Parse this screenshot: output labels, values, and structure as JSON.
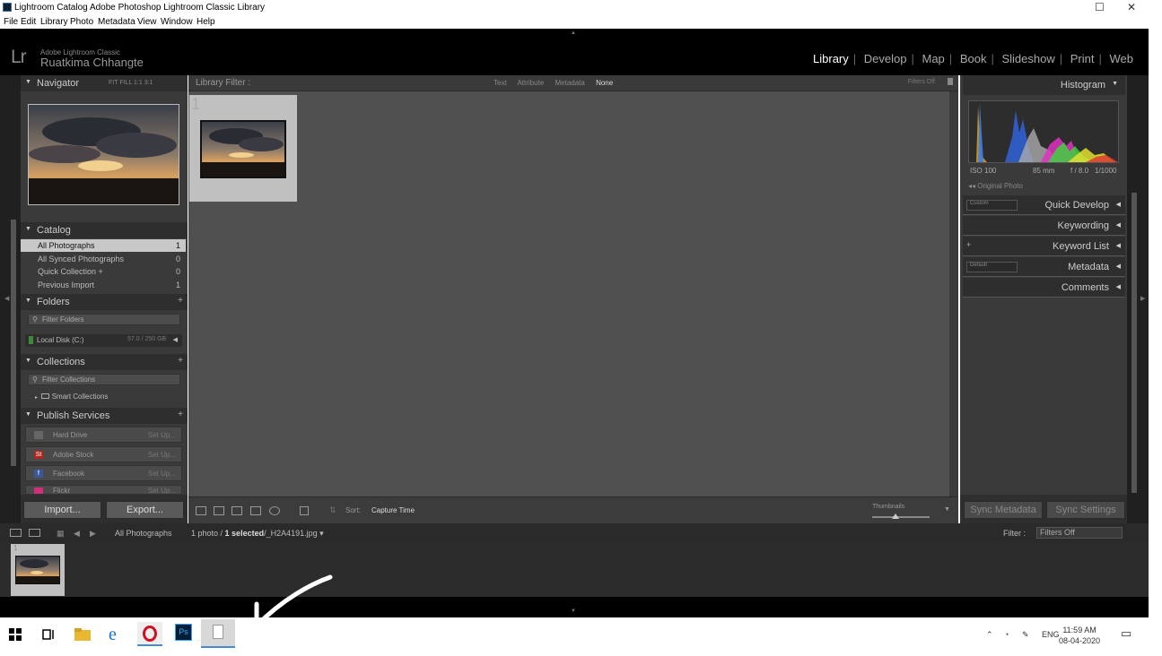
{
  "window": {
    "title": "Lightroom Catalog  Adobe Photoshop Lightroom Classic  Library",
    "menu": [
      "File",
      "Edit",
      "Library",
      "Photo",
      "Metadata",
      "View",
      "Window",
      "Help"
    ]
  },
  "identity": {
    "logo": "Lr",
    "app_name": "Adobe Lightroom Classic",
    "user": "Ruatkima Chhangte"
  },
  "modules": [
    {
      "label": "Library",
      "active": true
    },
    {
      "label": "Develop",
      "active": false
    },
    {
      "label": "Map",
      "active": false
    },
    {
      "label": "Book",
      "active": false
    },
    {
      "label": "Slideshow",
      "active": false
    },
    {
      "label": "Print",
      "active": false
    },
    {
      "label": "Web",
      "active": false
    }
  ],
  "left_panel": {
    "navigator": {
      "title": "Navigator",
      "zoom_options": [
        "FIT",
        "FILL",
        "1:1",
        "3:1"
      ]
    },
    "catalog": {
      "title": "Catalog",
      "items": [
        {
          "name": "All Photographs",
          "count": "1"
        },
        {
          "name": "All Synced Photographs",
          "count": "0"
        },
        {
          "name": "Quick Collection +",
          "count": "0"
        },
        {
          "name": "Previous Import",
          "count": "1"
        }
      ]
    },
    "folders": {
      "title": "Folders",
      "filter": "Filter Folders",
      "disk": "Local Disk (C:)",
      "disk_size": "57.0 / 250 GB"
    },
    "collections": {
      "title": "Collections",
      "filter": "Filter Collections",
      "smart": "Smart Collections"
    },
    "publish": {
      "title": "Publish Services",
      "items": [
        {
          "name": "Hard Drive",
          "action": "Set Up...",
          "icon": "hard-drive-icon",
          "color": "#666666"
        },
        {
          "name": "Adobe Stock",
          "action": "Set Up...",
          "icon": "adobe-stock-icon",
          "color": "#b3261e",
          "glyph": "St"
        },
        {
          "name": "Facebook",
          "action": "Set Up...",
          "icon": "facebook-icon",
          "color": "#3b5998",
          "glyph": "f"
        },
        {
          "name": "Flickr",
          "action": "Set Up...",
          "icon": "flickr-icon",
          "color": "#d0307a",
          "glyph": ""
        }
      ]
    },
    "import_label": "Import...",
    "export_label": "Export..."
  },
  "filter_bar": {
    "label": "Library Filter :",
    "options": [
      {
        "label": "Text",
        "on": false
      },
      {
        "label": "Attribute",
        "on": false
      },
      {
        "label": "Metadata",
        "on": false
      },
      {
        "label": "None",
        "on": true
      }
    ],
    "filters_off": "Filters Off"
  },
  "grid": {
    "cell_number": "1"
  },
  "toolbar": {
    "sort_label": "Sort:",
    "sort_value": "Capture Time",
    "thumbnails_label": "Thumbnails"
  },
  "right_panel": {
    "histogram": {
      "title": "Histogram",
      "iso": "ISO 100",
      "focal": "85 mm",
      "aperture": "f / 8.0",
      "shutter": "1/1000",
      "original": "Original Photo"
    },
    "sections": [
      {
        "label": "Quick Develop",
        "selector": "Custom"
      },
      {
        "label": "Keywording"
      },
      {
        "label": "Keyword List",
        "plus": "+"
      },
      {
        "label": "Metadata",
        "selector": "Default"
      },
      {
        "label": "Comments"
      }
    ],
    "sync_metadata": "Sync Metadata",
    "sync_settings": "Sync Settings"
  },
  "filmstrip": {
    "source": "All Photographs",
    "count_prefix": "1 photo /",
    "selected": "1 selected",
    "filename": "/_H2A4191.jpg",
    "filter_label": "Filter :",
    "filter_value": "Filters Off",
    "cell_number": "1"
  },
  "taskbar": {
    "time": "11:59 AM",
    "date": "08-04-2020",
    "lang": "ENG"
  },
  "colors": {
    "accent": "#ffffff",
    "panel": "#3a3a3a",
    "grid": "#505050"
  }
}
